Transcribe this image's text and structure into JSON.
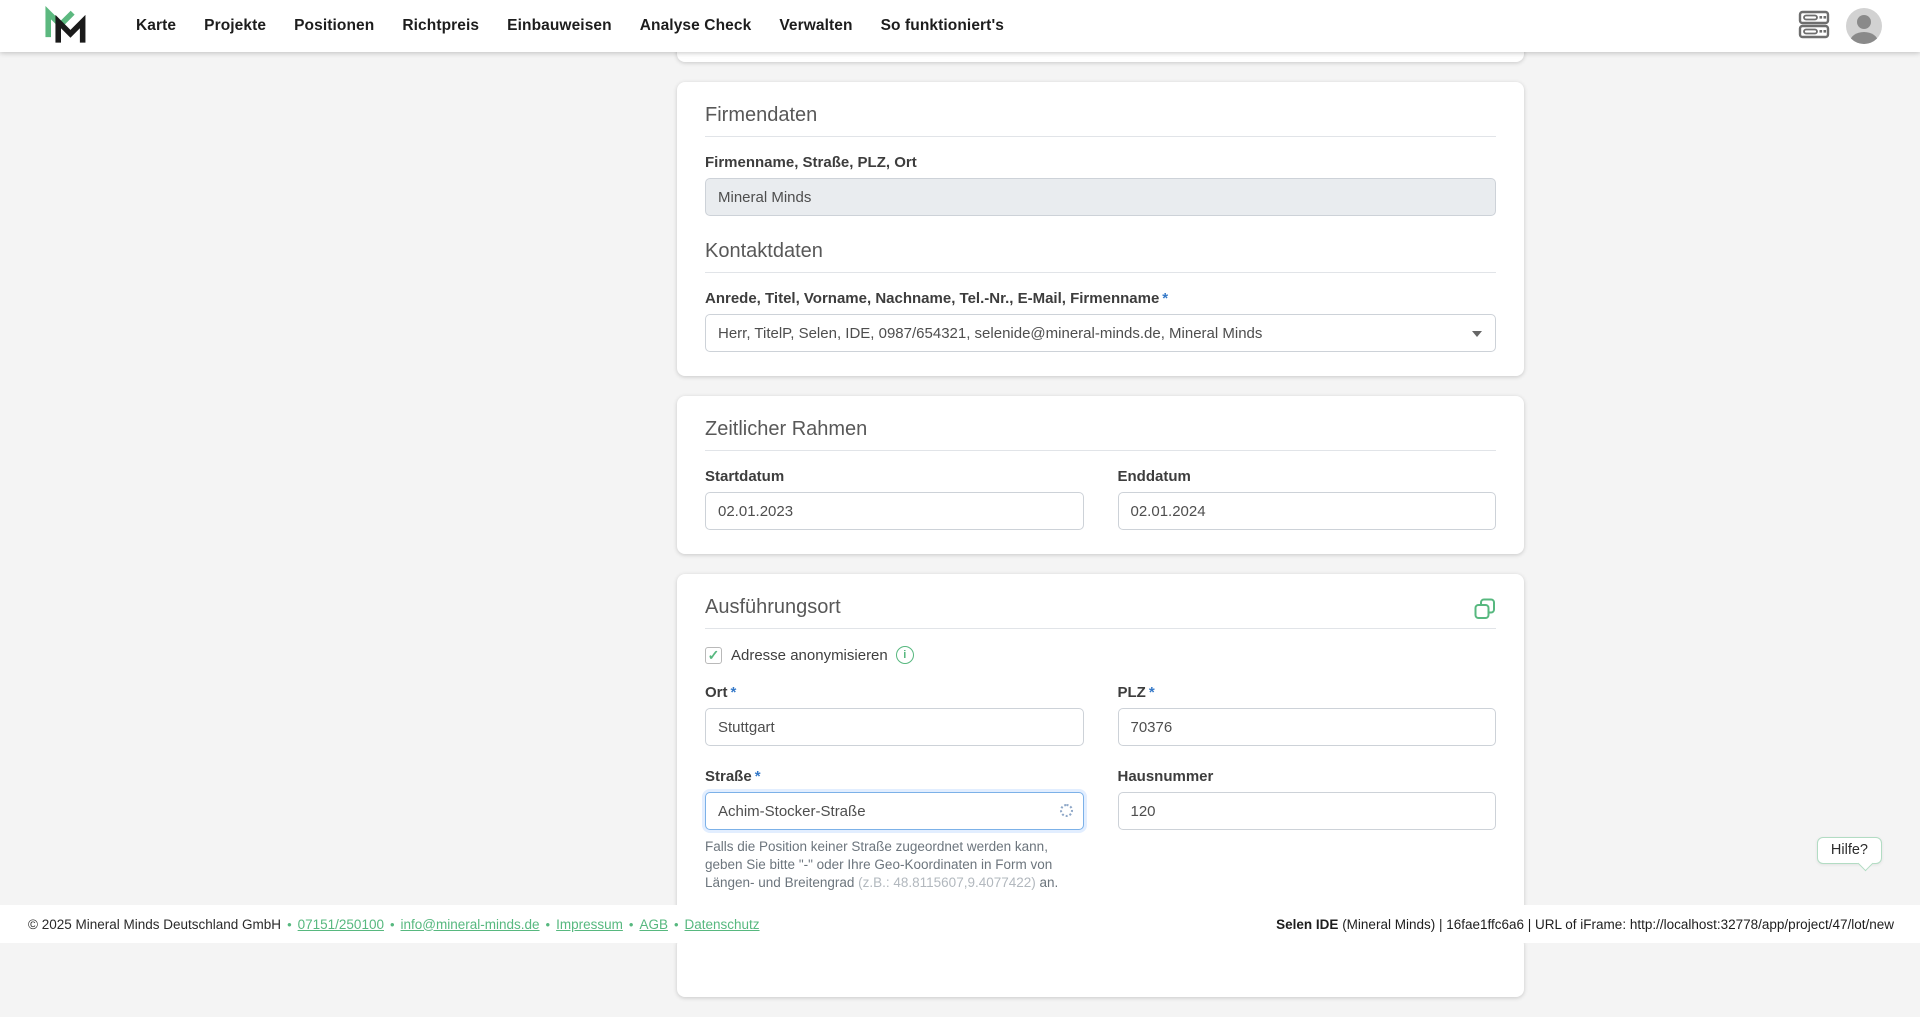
{
  "brand": {
    "green": "#57b87f",
    "blue_required": "#3579c8",
    "focus_blue": "#7cb1e8"
  },
  "header": {
    "nav": [
      "Karte",
      "Projekte",
      "Positionen",
      "Richtpreis",
      "Einbauweisen",
      "Analyse Check",
      "Verwalten",
      "So funktioniert's"
    ],
    "icons": [
      "server-stack-icon",
      "user-avatar-icon"
    ]
  },
  "required_mark": "*",
  "firmendaten": {
    "title": "Firmendaten",
    "company_label": "Firmenname, Straße, PLZ, Ort",
    "company_value": "Mineral Minds",
    "kontakt_title": "Kontaktdaten",
    "contact_label": "Anrede, Titel, Vorname, Nachname, Tel.-Nr., E-Mail, Firmenname",
    "contact_value": "Herr, TitelP, Selen, IDE, 0987/654321, selenide@mineral-minds.de, Mineral Minds"
  },
  "zeitraum": {
    "title": "Zeitlicher Rahmen",
    "start_label": "Startdatum",
    "start_value": "02.01.2023",
    "end_label": "Enddatum",
    "end_value": "02.01.2024"
  },
  "ausfuehrungsort": {
    "title": "Ausführungsort",
    "anonymize_label": "Adresse anonymisieren",
    "checkbox_checked": "✓",
    "info_glyph": "i",
    "ort_label": "Ort",
    "ort_value": "Stuttgart",
    "plz_label": "PLZ",
    "plz_value": "70376",
    "strasse_label": "Straße",
    "strasse_value": "Achim-Stocker-Straße",
    "hausnummer_label": "Hausnummer",
    "hausnummer_value": "120",
    "hint_prefix": "Falls die Position keiner Straße zugeordnet werden kann, geben Sie bitte \"-\" oder Ihre Geo-Koordinaten in Form von Längen- und Breitengrad ",
    "hint_coords": "(z.B.: 48.8115607,9.4077422)",
    "hint_suffix": " an."
  },
  "help_button": {
    "label": "Hilfe?"
  },
  "footer": {
    "copyright": "© 2025 Mineral Minds Deutschland GmbH",
    "separator": "•",
    "phone": "07151/250100",
    "email": "info@mineral-minds.de",
    "impressum": "Impressum",
    "agb": "AGB",
    "datenschutz": "Datenschutz",
    "ide_bold": "Selen IDE",
    "ide_rest": " (Mineral Minds) | 16fae1ffc6a6 | URL of iFrame: http://localhost:32778/app/project/47/lot/new"
  }
}
